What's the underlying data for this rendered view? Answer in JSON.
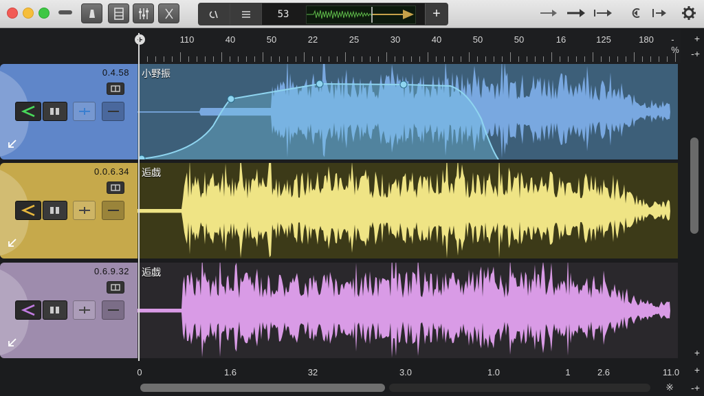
{
  "toolbar": {
    "lcd_position": "53",
    "seg1_icon": "loop-icon",
    "seg2_icon": "list-icon",
    "add_label": "+",
    "nav_icons": [
      "arrow-right-icon",
      "arrow-right-bold-icon",
      "skip-end-icon",
      "rewind-icon",
      "next-marker-icon",
      "settings-icon"
    ]
  },
  "ruler": {
    "labels": [
      "110",
      "40",
      "50",
      "22",
      "25",
      "30",
      "40",
      "50",
      "50",
      "16",
      "125",
      "180",
      "-%"
    ]
  },
  "tracks": [
    {
      "time": "0.4.58",
      "name": "小野振",
      "color": "#5f86c9",
      "lane": "#3d5f79",
      "wave": "#79a8e0"
    },
    {
      "time": "0.0.6.34",
      "name": "逅戯",
      "color": "#c6a94b",
      "lane": "#3c3a18",
      "wave": "#efe485"
    },
    {
      "time": "0.6.9.32",
      "name": "逅戯",
      "color": "#9e8cad",
      "lane": "#2a282c",
      "wave": "#d99be6"
    }
  ],
  "bottom_ruler": {
    "labels": [
      "0",
      "1.6",
      "32",
      "3.0",
      "1.0",
      "1",
      "2.6",
      "11.0"
    ]
  },
  "right_icons": [
    "+",
    "+",
    "+",
    "+",
    "-+"
  ],
  "bottom_right_icon": "※"
}
